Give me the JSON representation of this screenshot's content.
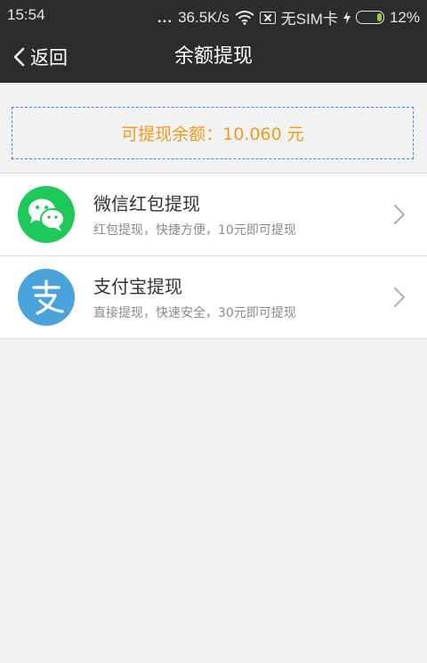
{
  "status_bar": {
    "time": "15:54",
    "dots": "...",
    "net_speed": "36.5K/s",
    "sim": "无SIM卡",
    "battery": "12%",
    "icons": [
      "wifi-icon",
      "sim-icon",
      "charging-icon",
      "battery-icon"
    ]
  },
  "header": {
    "back_label": "返回",
    "title": "余额提现"
  },
  "balance": {
    "text": "可提现余额：10.060 元"
  },
  "options": [
    {
      "title": "微信红包提现",
      "subtitle": "红包提现，快捷方便，10元即可提现",
      "icon": "wechat-icon"
    },
    {
      "title": "支付宝提现",
      "subtitle": "直接提现，快速安全，30元即可提现",
      "icon": "alipay-icon"
    }
  ],
  "colors": {
    "bar_bg": "#2c2c2c",
    "accent_orange": "#f09a1a",
    "dash_border": "#4a86d8",
    "wechat_green": "#1ec95a",
    "alipay_blue": "#4ba3dc"
  }
}
